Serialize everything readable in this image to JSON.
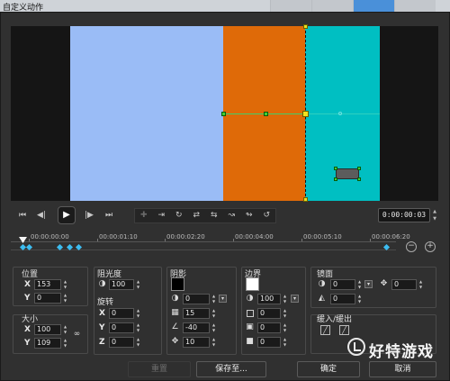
{
  "window": {
    "title": "自定义动作"
  },
  "preview": {
    "colors": {
      "lightblue": "#9abcf6",
      "orange": "#df6a08",
      "cyan": "#00bfc2",
      "background": "#151515"
    }
  },
  "transport": {
    "timecode": "0:00:00:03"
  },
  "timeline": {
    "ticks": [
      "00:00:00:00",
      "00:00:01:10",
      "00:00:02:20",
      "00:00:04:00",
      "00:00:05:10",
      "00:00:06:20"
    ]
  },
  "position": {
    "label": "位置",
    "x_label": "X",
    "x": "153",
    "y_label": "Y",
    "y": "0"
  },
  "size": {
    "label": "大小",
    "x_label": "X",
    "x": "100",
    "y_label": "Y",
    "y": "109"
  },
  "opacity": {
    "label": "阻光度",
    "value": "100"
  },
  "rotation": {
    "label": "旋转",
    "x_label": "X",
    "x": "0",
    "y_label": "Y",
    "y": "0",
    "z_label": "Z",
    "z": "0"
  },
  "shadow": {
    "label": "阴影",
    "color": "#000000",
    "opacity": "0",
    "blur": "15",
    "angle": "-40",
    "distance": "10"
  },
  "border": {
    "label": "边界",
    "color": "#ffffff",
    "opacity": "100",
    "width": "0",
    "v2": "0",
    "v3": "0"
  },
  "mirror": {
    "label": "镜面",
    "opacity": "0",
    "offset": "0",
    "fade": "0"
  },
  "ease": {
    "label": "缓入/缓出"
  },
  "buttons": {
    "reset": "重置",
    "save_to": "保存至...",
    "ok": "确定",
    "cancel": "取消"
  },
  "watermark": {
    "text": "好特游戏"
  }
}
